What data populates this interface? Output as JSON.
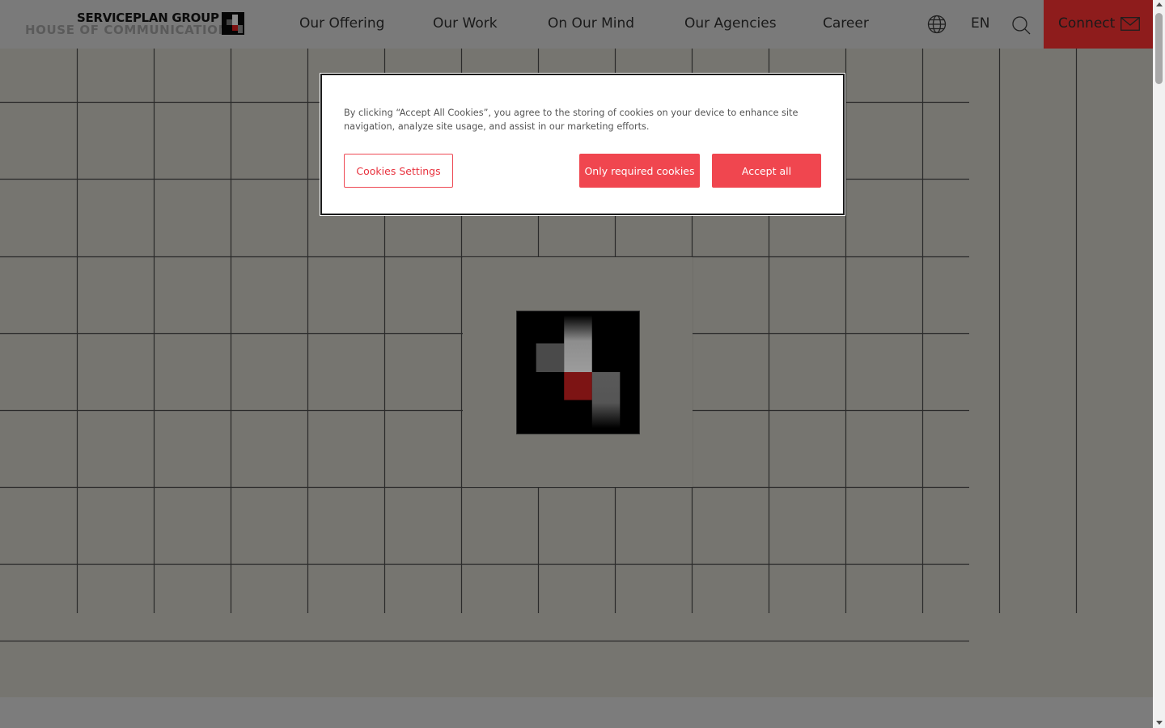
{
  "header": {
    "logo": {
      "line1": "SERVICEPLAN GROUP",
      "line2": "HOUSE OF COMMUNICATION"
    },
    "nav": [
      "Our Offering",
      "Our Work",
      "On Our Mind",
      "Our Agencies",
      "Career"
    ],
    "language": "EN",
    "connect_label": "Connect",
    "connect_color": "#8e1c1c",
    "icons": [
      "globe-icon",
      "search-icon",
      "mail-icon"
    ]
  },
  "cookie_banner": {
    "text": "By clicking “Accept All Cookies”, you agree to the storing of cookies on your device to enhance site navigation, analyze site usage, and assist in our marketing efforts.",
    "buttons": {
      "settings": "Cookies Settings",
      "required": "Only required cookies",
      "accept": "Accept all"
    },
    "accent_color": "#f0464f"
  },
  "hero": {
    "logo_mark_colors": [
      "#000000",
      "#4a4a4a",
      "#9a9a9a",
      "#8e1414"
    ]
  }
}
